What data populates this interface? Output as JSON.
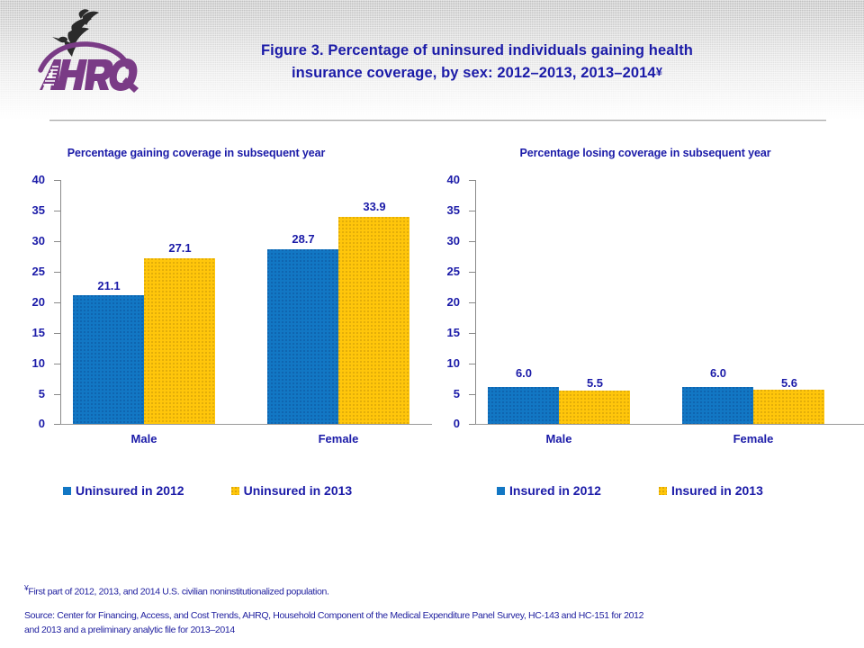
{
  "header": {
    "logo_alt": "AHRQ - Agency for Healthcare Research and Quality",
    "title_line1": "Figure 3. Percentage of uninsured individuals gaining health",
    "title_line2": "insurance coverage, by sex: 2012–2013, 2013–2014",
    "title_footnote_marker": "¥"
  },
  "colors": {
    "title_blue": "#1b1ba8",
    "series_blue": "#1277c4",
    "series_gold": "#ffc60b",
    "axis_gray": "#8a8a8a",
    "footnote_blue": "#2222a0"
  },
  "notes": {
    "footnote_marker": "¥",
    "footnote_text": "First part of 2012, 2013, and 2014 U.S. civilian noninstitutionalized population.",
    "source_line1": "Source: Center for Financing, Access, and Cost Trends, AHRQ, Household Component of the Medical Expenditure Panel Survey,  HC-143 and HC-151 for 2012",
    "source_line2": "and 2013 and a preliminary analytic file for 2013–2014"
  },
  "chart_data": [
    {
      "type": "bar",
      "id": "gaining",
      "title": "Percentage gaining coverage in subsequent year",
      "xlabel": "",
      "ylabel": "",
      "ylim": [
        0,
        40
      ],
      "yticks": [
        0,
        5,
        10,
        15,
        20,
        25,
        30,
        35,
        40
      ],
      "ytick_labels": [
        "0",
        "5",
        "10",
        "15",
        "20",
        "25",
        "30",
        "35",
        "40"
      ],
      "grid": false,
      "legend_position": "bottom",
      "categories": [
        "Male",
        "Female"
      ],
      "series": [
        {
          "name": "Uninsured in 2012",
          "color": "#1277c4",
          "values": [
            21.1,
            28.7
          ],
          "labels": [
            "21.1",
            "28.7"
          ]
        },
        {
          "name": "Uninsured in 2013",
          "color": "#ffc60b",
          "values": [
            27.1,
            33.9
          ],
          "labels": [
            "27.1",
            "33.9"
          ]
        }
      ]
    },
    {
      "type": "bar",
      "id": "losing",
      "title": "Percentage losing coverage in subsequent year",
      "xlabel": "",
      "ylabel": "",
      "ylim": [
        0,
        40
      ],
      "yticks": [
        0,
        5,
        10,
        15,
        20,
        25,
        30,
        35,
        40
      ],
      "ytick_labels": [
        "0",
        "5",
        "10",
        "15",
        "20",
        "25",
        "30",
        "35",
        "40"
      ],
      "grid": false,
      "legend_position": "bottom",
      "categories": [
        "Male",
        "Female"
      ],
      "series": [
        {
          "name": "Insured in 2012",
          "color": "#1277c4",
          "values": [
            6.0,
            6.0
          ],
          "labels": [
            "6.0",
            "6.0"
          ]
        },
        {
          "name": "Insured in 2013",
          "color": "#ffc60b",
          "values": [
            5.5,
            5.6
          ],
          "labels": [
            "5.5",
            "5.6"
          ]
        }
      ]
    }
  ]
}
